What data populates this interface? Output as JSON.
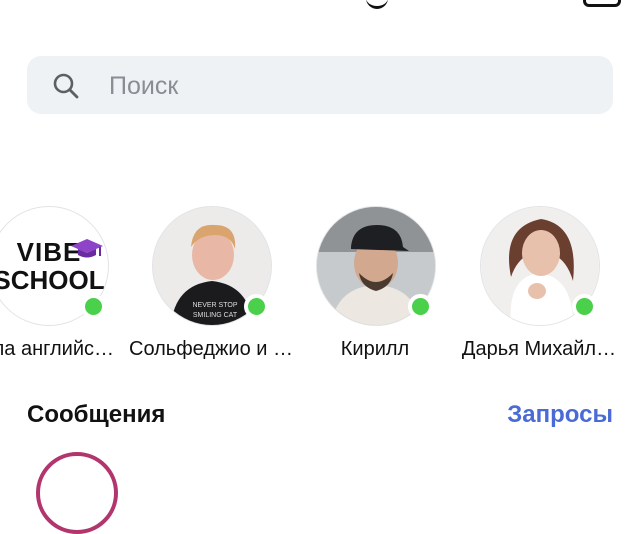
{
  "search": {
    "placeholder": "Поиск",
    "icon": "search-icon"
  },
  "stories": [
    {
      "name": "Школа английского",
      "visible_text": "ола английс…",
      "avatar_text_line1": "VIBE",
      "avatar_text_line2": "SCHOOL",
      "online": true
    },
    {
      "name": "Сольфеджио и …",
      "visible_text": "Сольфеджио и …",
      "online": true
    },
    {
      "name": "Кирилл",
      "visible_text": "Кирилл",
      "online": true
    },
    {
      "name": "Дарья Михайл…",
      "visible_text": "Дарья Михайл…",
      "online": true
    }
  ],
  "messages": {
    "title": "Сообщения",
    "requests_label": "Запросы"
  },
  "colors": {
    "online": "#4bd04b",
    "link": "#4a6bd6",
    "search_bg": "#eff2f4"
  }
}
